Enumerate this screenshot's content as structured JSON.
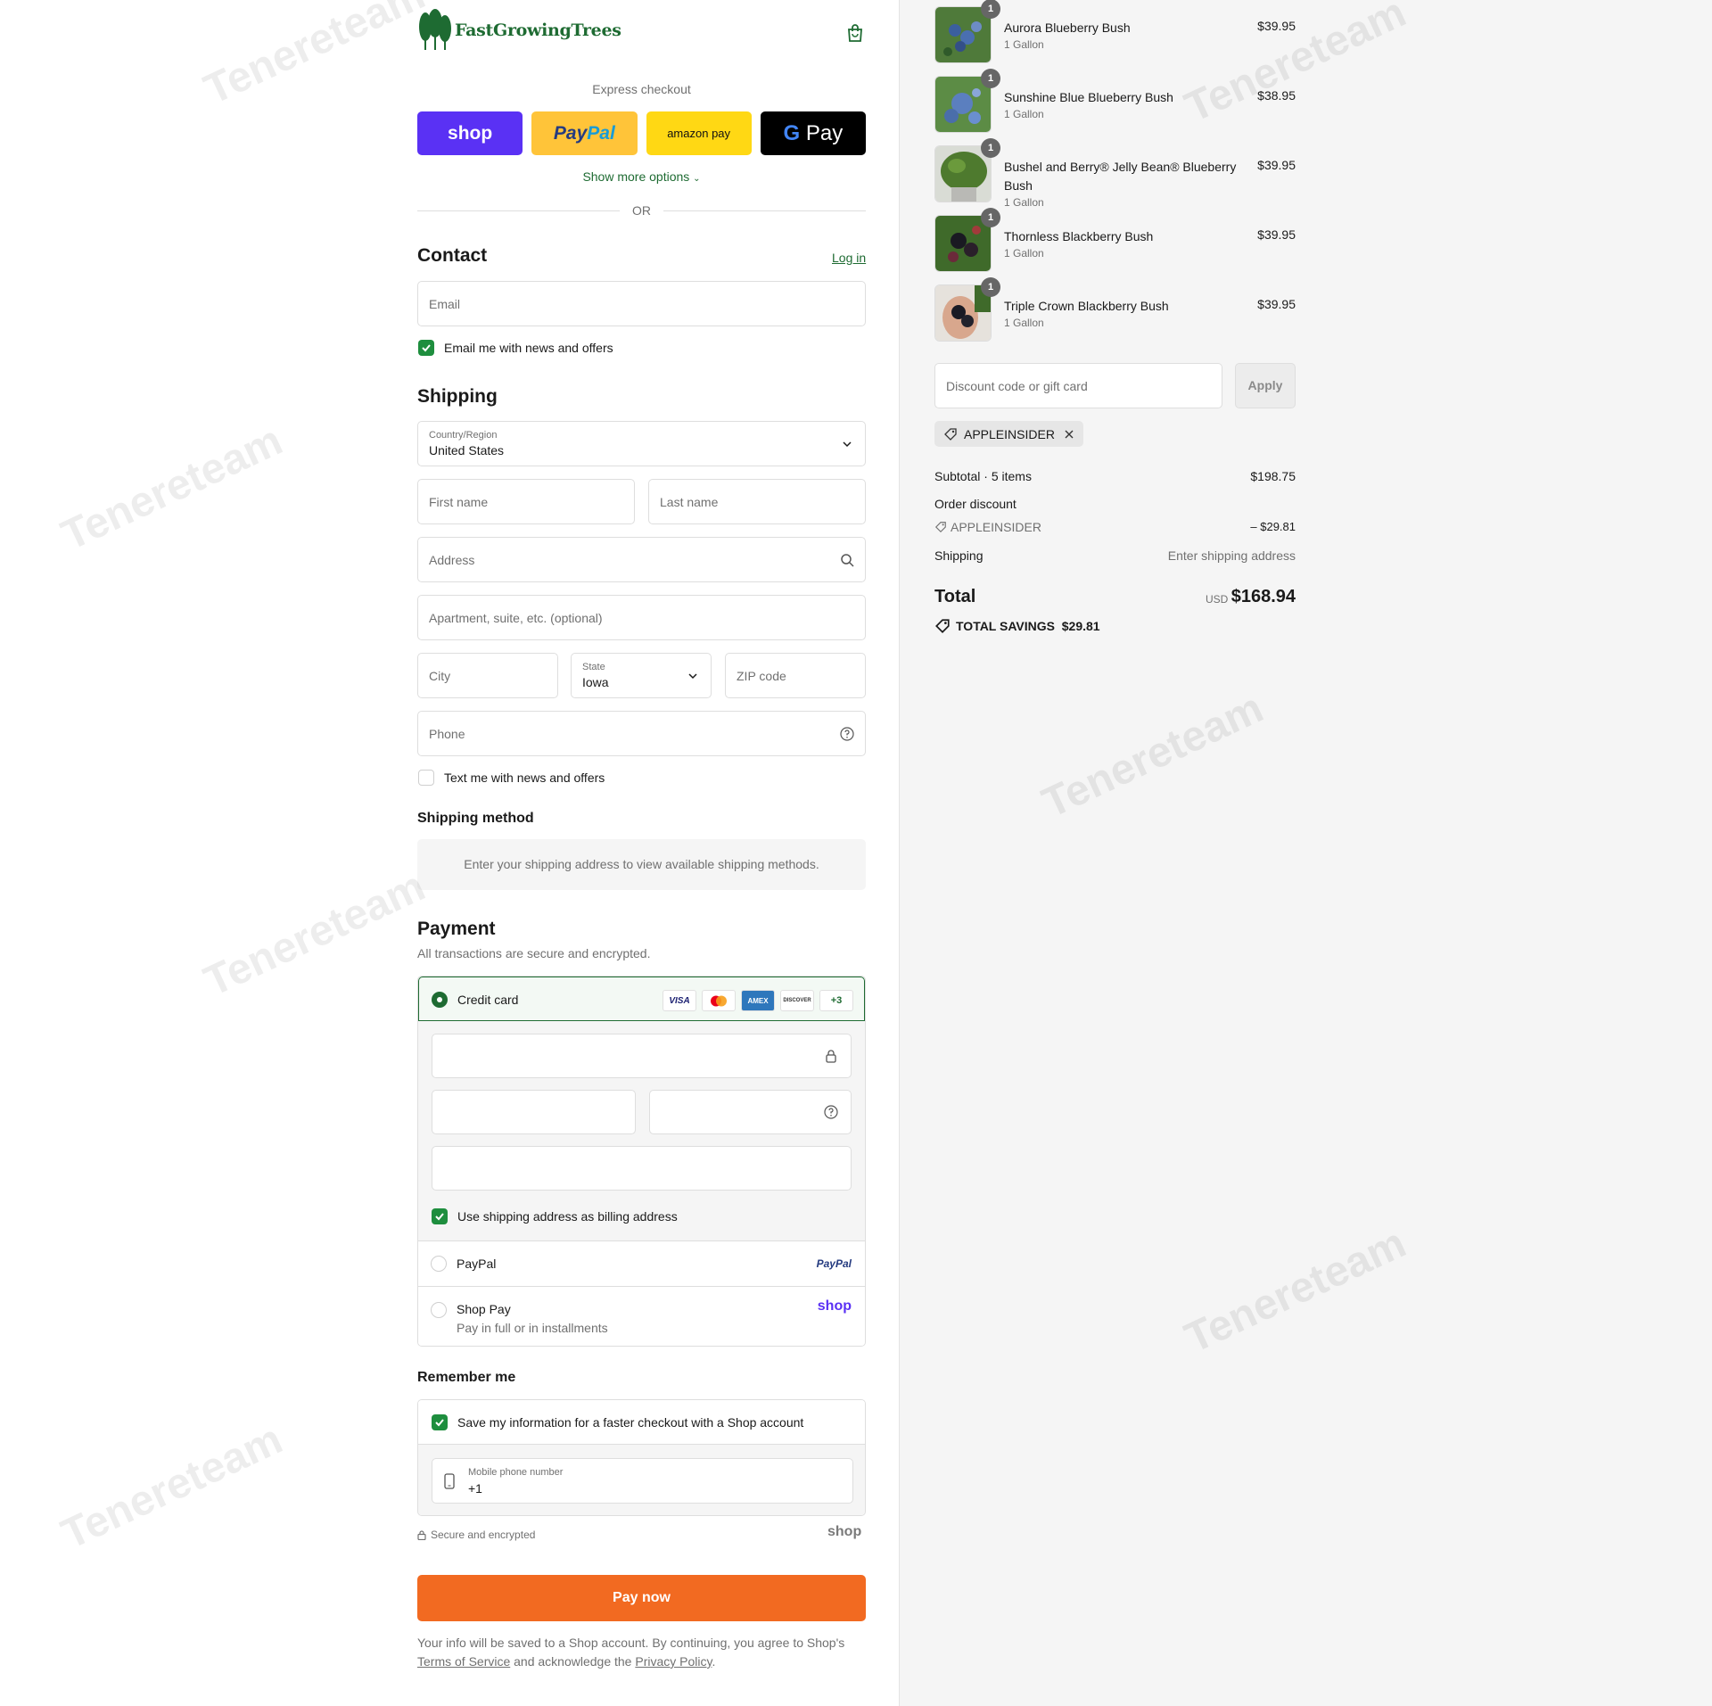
{
  "brand": {
    "name": "FastGrowingTrees",
    "green": "#1e6b32"
  },
  "express": {
    "title": "Express checkout",
    "buttons": [
      "shop",
      "PayPal",
      "amazon pay",
      "G Pay"
    ],
    "show_more": "Show more options",
    "or": "OR"
  },
  "contact": {
    "title": "Contact",
    "login": "Log in",
    "email_placeholder": "Email",
    "newsletter_label": "Email me with news and offers",
    "newsletter_checked": true
  },
  "shipping": {
    "title": "Shipping",
    "country_label": "Country/Region",
    "country_value": "United States",
    "first_name": "First name",
    "last_name": "Last name",
    "address": "Address",
    "apartment": "Apartment, suite, etc. (optional)",
    "city": "City",
    "state_label": "State",
    "state_value": "Iowa",
    "zip": "ZIP code",
    "phone": "Phone",
    "sms_label": "Text me with news and offers",
    "sms_checked": false
  },
  "shipping_method": {
    "title": "Shipping method",
    "message": "Enter your shipping address to view available shipping methods."
  },
  "payment": {
    "title": "Payment",
    "subtitle": "All transactions are secure and encrypted.",
    "credit_card": "Credit card",
    "card_brands": [
      "VISA",
      "mastercard",
      "AMEX",
      "DISCOVER",
      "+3"
    ],
    "billing_same": "Use shipping address as billing address",
    "paypal": "PayPal",
    "paypal_logo": "PayPal",
    "shop_pay": "Shop Pay",
    "shop_pay_sub": "Pay in full or in installments",
    "shop_pay_logo": "shop"
  },
  "remember": {
    "title": "Remember me",
    "save_label": "Save my information for a faster checkout with a Shop account",
    "phone_label": "Mobile phone number",
    "phone_value": "+1",
    "secure": "Secure and encrypted",
    "shop_logo": "shop"
  },
  "pay_now": "Pay now",
  "legal": {
    "line1": "Your info will be saved to a Shop account. By continuing, you agree to Shop's",
    "terms": "Terms of Service",
    "mid": "and acknowledge the",
    "privacy": "Privacy Policy",
    "end": "."
  },
  "cart": {
    "items": [
      {
        "qty": "1",
        "name": "Aurora Blueberry Bush",
        "variant": "1 Gallon",
        "price": "$39.95"
      },
      {
        "qty": "1",
        "name": "Sunshine Blue Blueberry Bush",
        "variant": "1 Gallon",
        "price": "$38.95"
      },
      {
        "qty": "1",
        "name": "Bushel and Berry® Jelly Bean® Blueberry Bush",
        "variant": "1 Gallon",
        "price": "$39.95"
      },
      {
        "qty": "1",
        "name": "Thornless Blackberry Bush",
        "variant": "1 Gallon",
        "price": "$39.95"
      },
      {
        "qty": "1",
        "name": "Triple Crown Blackberry Bush",
        "variant": "1 Gallon",
        "price": "$39.95"
      }
    ],
    "discount_placeholder": "Discount code or gift card",
    "apply": "Apply",
    "applied_code": "APPLEINSIDER",
    "subtotal_label": "Subtotal · 5 items",
    "subtotal_value": "$198.75",
    "order_discount_label": "Order discount",
    "order_discount_code": "APPLEINSIDER",
    "order_discount_value": "– $29.81",
    "shipping_label": "Shipping",
    "shipping_value": "Enter shipping address",
    "total_label": "Total",
    "currency": "USD",
    "total_value": "$168.94",
    "savings_label": "TOTAL SAVINGS",
    "savings_value": "$29.81"
  },
  "watermark": "Tenereteam"
}
